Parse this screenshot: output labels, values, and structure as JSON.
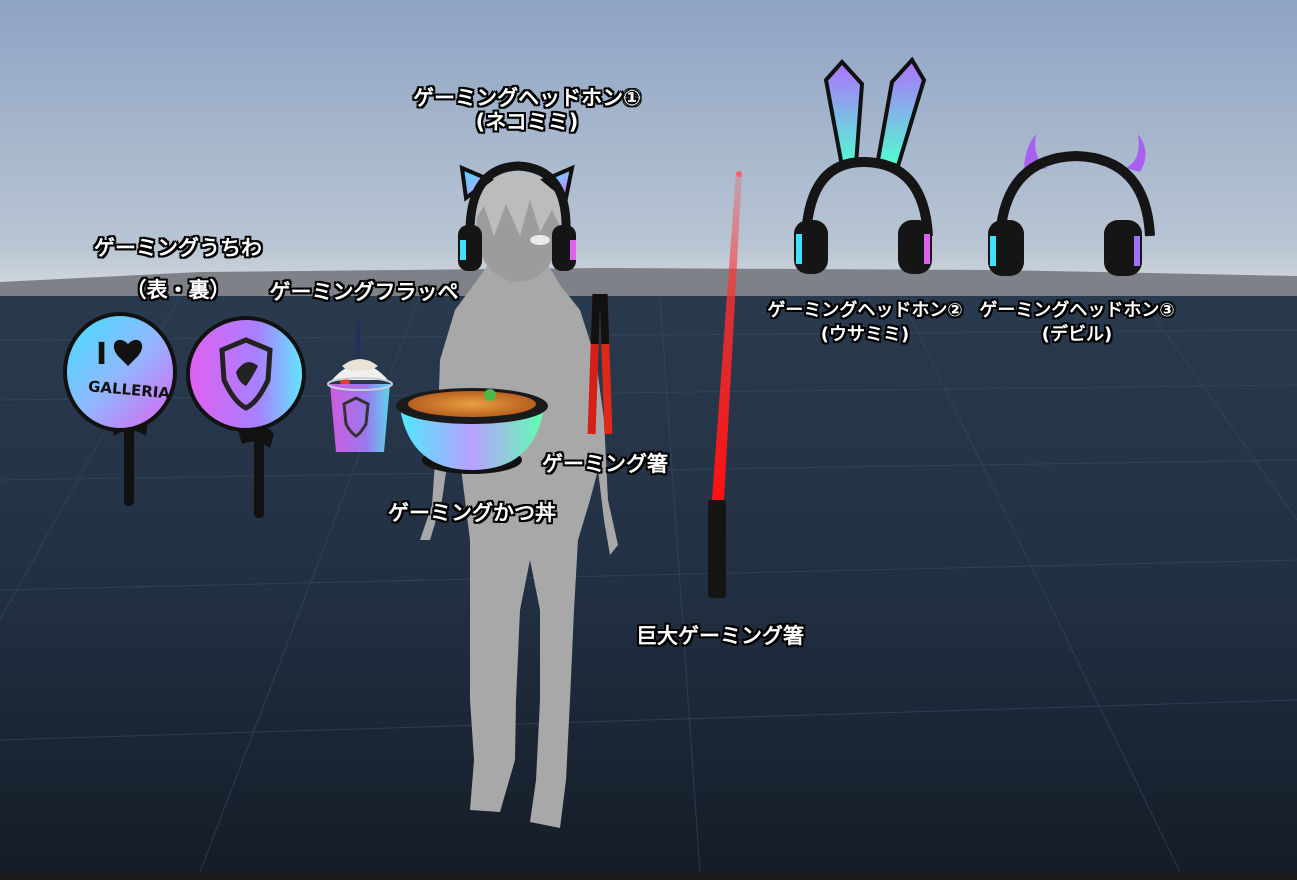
{
  "labels": {
    "headphone1_line1": "ゲーミングヘッドホン①",
    "headphone1_line2": "(ネコミミ)",
    "uchiwa_line1": "ゲーミングうちわ",
    "uchiwa_line2": "（表・裏）",
    "frappe": "ゲーミングフラッペ",
    "headphone2_line1": "ゲーミングヘッドホン②",
    "headphone2_line2": "(ウサミミ)",
    "headphone3_line1": "ゲーミングヘッドホン③",
    "headphone3_line2": "(デビル)",
    "chopsticks": "ゲーミング箸",
    "katsudon": "ゲーミングかつ丼",
    "giant_chopsticks": "巨大ゲーミング箸"
  },
  "uchiwa_front_text": {
    "line1": "I",
    "line2": "GALLERIA"
  },
  "status_text": "",
  "icons": [
    "cat-ear-headphones",
    "bunny-ear-headphones",
    "devil-horn-headphones",
    "heart-icon",
    "shield-logo-icon",
    "frappe-cup",
    "katsudon-bowl",
    "chopsticks",
    "giant-chopstick"
  ],
  "colors": {
    "sky_top": "#8fa5c6",
    "sky_horizon": "#c9d2dc",
    "ground": "#1f2c3d",
    "gaming_cyan": "#3fd8ff",
    "gaming_pink": "#e064f0",
    "chopstick_red": "#ff2020"
  }
}
